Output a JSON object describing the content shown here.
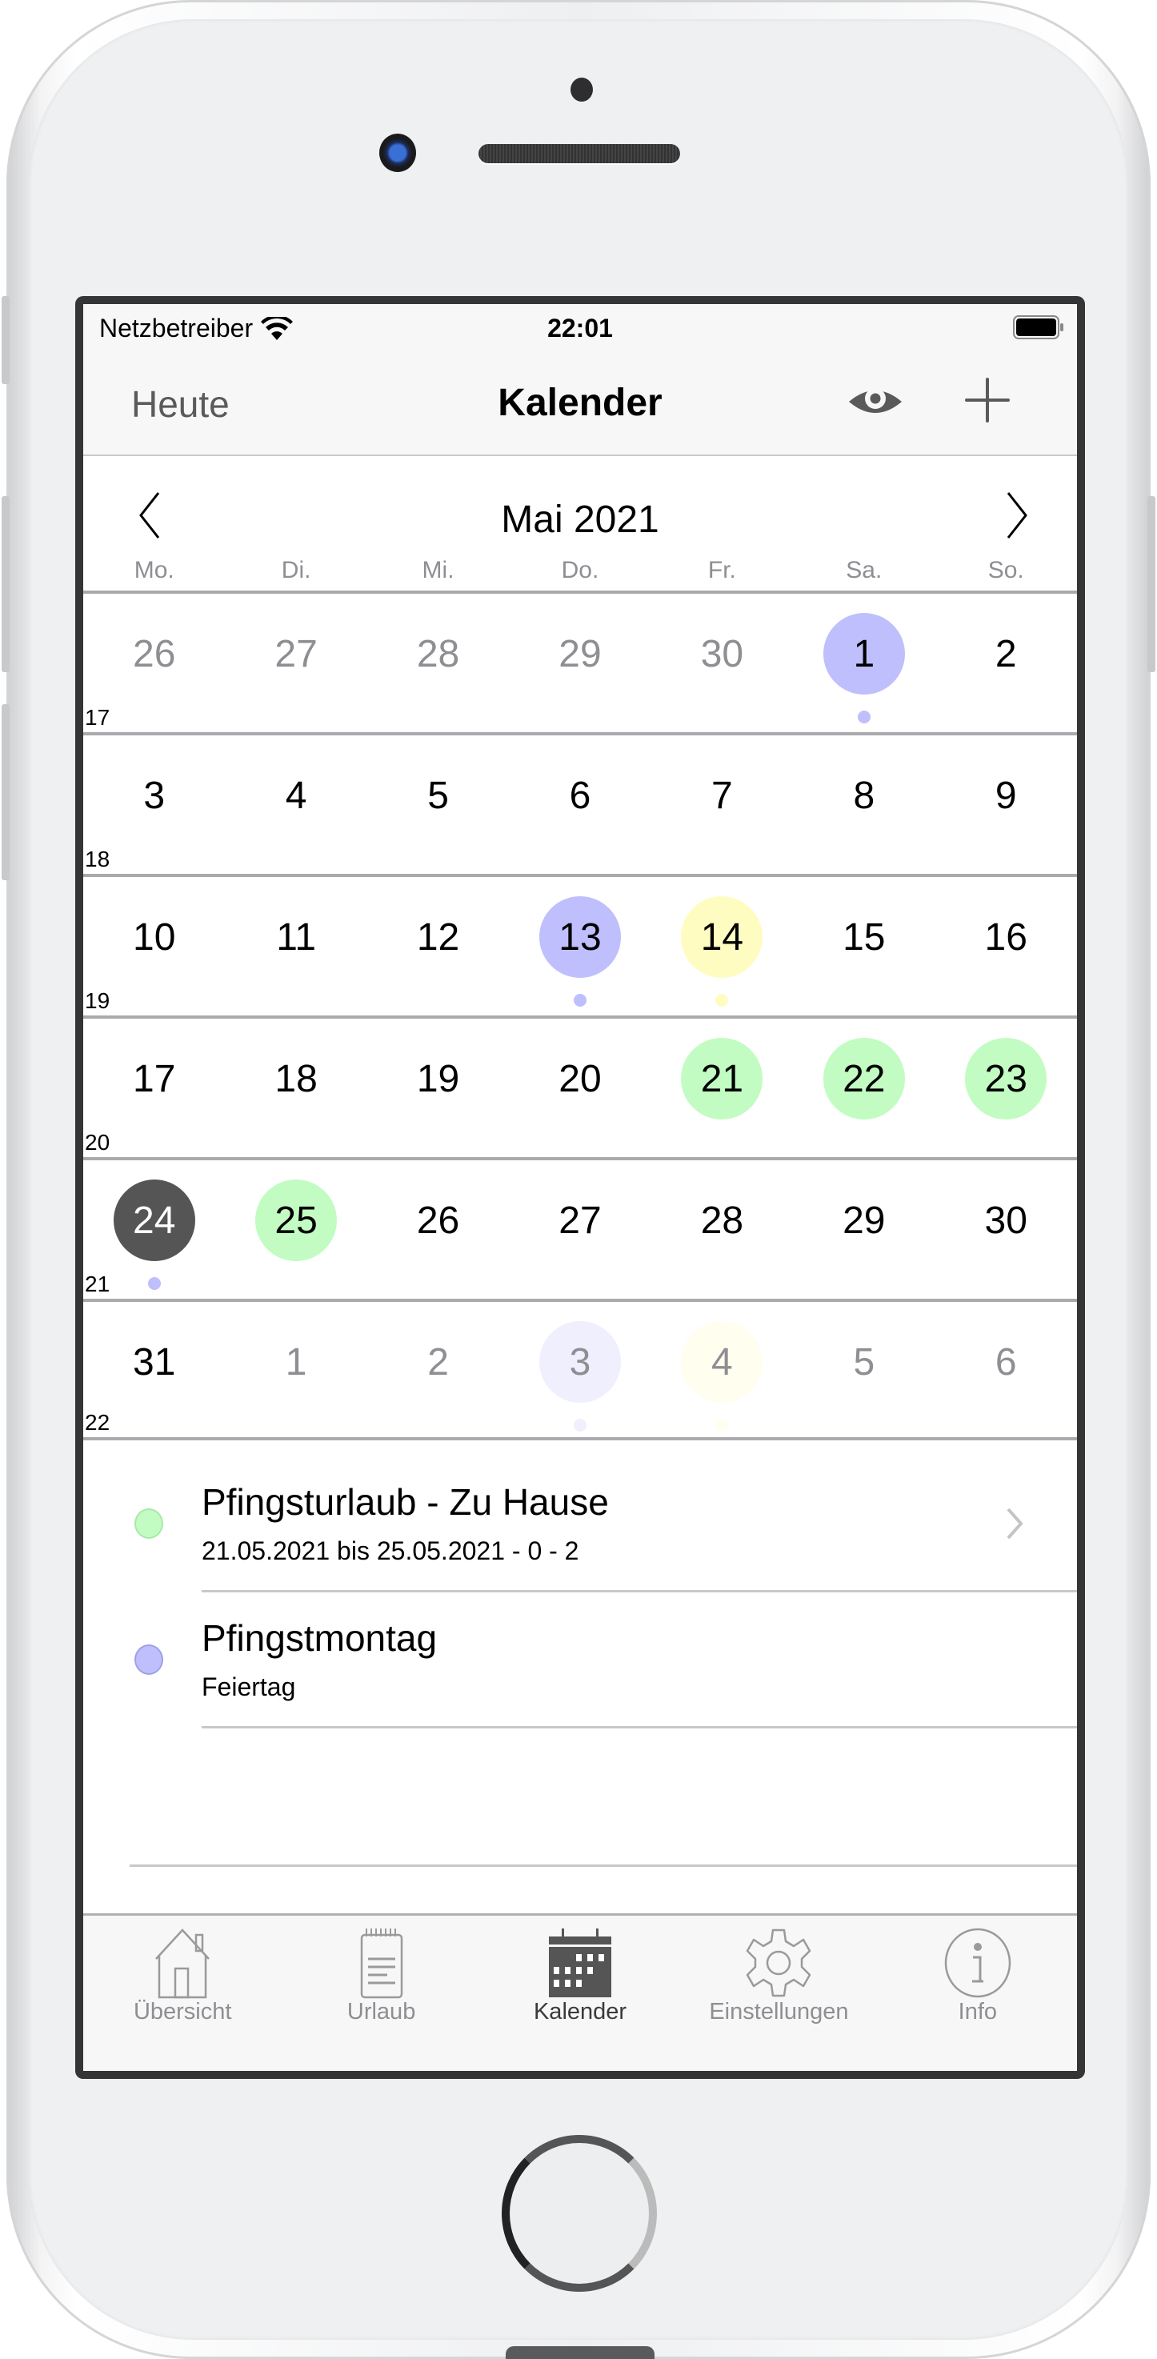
{
  "status_bar": {
    "carrier": "Netzbetreiber",
    "time": "22:01"
  },
  "nav": {
    "left_button": "Heute",
    "title": "Kalender"
  },
  "calendar": {
    "month_title": "Mai 2021",
    "weekdays": [
      "Mo.",
      "Di.",
      "Mi.",
      "Do.",
      "Fr.",
      "Sa.",
      "So."
    ],
    "colors": {
      "holiday": "#bfbffd",
      "vacation": "#c2fcc2",
      "yellow": "#fffcc2",
      "today": "#555555"
    },
    "weeks": [
      {
        "kw": "17",
        "days": [
          {
            "d": "26",
            "other": true
          },
          {
            "d": "27",
            "other": true
          },
          {
            "d": "28",
            "other": true
          },
          {
            "d": "29",
            "other": true
          },
          {
            "d": "30",
            "other": true
          },
          {
            "d": "1",
            "circle": "holiday",
            "dot": "holiday"
          },
          {
            "d": "2"
          }
        ]
      },
      {
        "kw": "18",
        "days": [
          {
            "d": "3"
          },
          {
            "d": "4"
          },
          {
            "d": "5"
          },
          {
            "d": "6"
          },
          {
            "d": "7"
          },
          {
            "d": "8"
          },
          {
            "d": "9"
          }
        ]
      },
      {
        "kw": "19",
        "days": [
          {
            "d": "10"
          },
          {
            "d": "11"
          },
          {
            "d": "12"
          },
          {
            "d": "13",
            "circle": "holiday",
            "dot": "holiday"
          },
          {
            "d": "14",
            "circle": "yellow",
            "dot": "yellow"
          },
          {
            "d": "15"
          },
          {
            "d": "16"
          }
        ]
      },
      {
        "kw": "20",
        "days": [
          {
            "d": "17"
          },
          {
            "d": "18"
          },
          {
            "d": "19"
          },
          {
            "d": "20"
          },
          {
            "d": "21",
            "circle": "vacation"
          },
          {
            "d": "22",
            "circle": "vacation"
          },
          {
            "d": "23",
            "circle": "vacation"
          }
        ]
      },
      {
        "kw": "21",
        "days": [
          {
            "d": "24",
            "circle": "today",
            "dot": "holiday"
          },
          {
            "d": "25",
            "circle": "vacation"
          },
          {
            "d": "26"
          },
          {
            "d": "27"
          },
          {
            "d": "28"
          },
          {
            "d": "29"
          },
          {
            "d": "30"
          }
        ]
      },
      {
        "kw": "22",
        "days": [
          {
            "d": "31"
          },
          {
            "d": "1",
            "other": true
          },
          {
            "d": "2",
            "other": true
          },
          {
            "d": "3",
            "other": true,
            "circle": "holiday",
            "dot": "holiday"
          },
          {
            "d": "4",
            "other": true,
            "circle": "yellow",
            "dot": "yellow"
          },
          {
            "d": "5",
            "other": true
          },
          {
            "d": "6",
            "other": true
          }
        ]
      }
    ]
  },
  "events": [
    {
      "title": "Pfingsturlaub - Zu Hause",
      "subtitle": "21.05.2021 bis 25.05.2021 - 0 - 2",
      "color": "#c2fcc2",
      "border": "#a8e8a8",
      "has_chevron": true
    },
    {
      "title": "Pfingstmontag",
      "subtitle": "Feiertag",
      "color": "#bfbffd",
      "border": "#9f9fe6",
      "has_chevron": false
    }
  ],
  "tabs": [
    {
      "label": "Übersicht",
      "icon": "house-icon",
      "active": false
    },
    {
      "label": "Urlaub",
      "icon": "notepad-icon",
      "active": false
    },
    {
      "label": "Kalender",
      "icon": "calendar-icon",
      "active": true
    },
    {
      "label": "Einstellungen",
      "icon": "gear-icon",
      "active": false
    },
    {
      "label": "Info",
      "icon": "info-icon",
      "active": false
    }
  ]
}
